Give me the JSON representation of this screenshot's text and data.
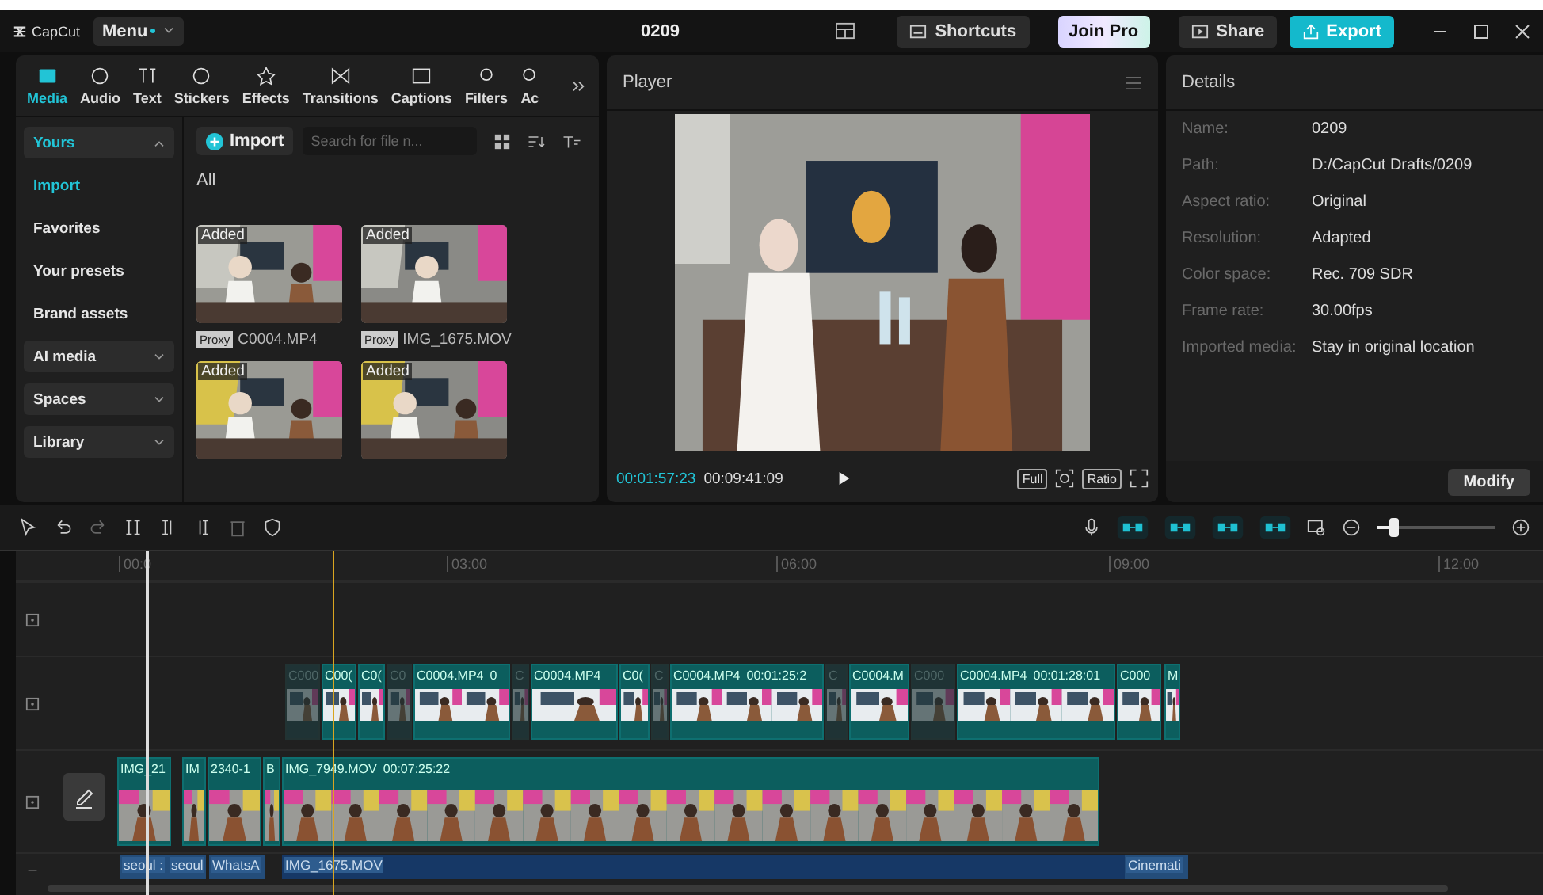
{
  "title_bar": {
    "logo": "CapCut",
    "menu": "Menu",
    "project": "0209",
    "shortcuts": "Shortcuts",
    "join_pro": "Join Pro",
    "share": "Share",
    "export": "Export"
  },
  "tabs": [
    {
      "label": "Media",
      "selected": true
    },
    {
      "label": "Audio",
      "selected": false
    },
    {
      "label": "Text",
      "selected": false
    },
    {
      "label": "Stickers",
      "selected": false
    },
    {
      "label": "Effects",
      "selected": false
    },
    {
      "label": "Transitions",
      "selected": false
    },
    {
      "label": "Captions",
      "selected": false
    },
    {
      "label": "Filters",
      "selected": false
    },
    {
      "label": "Ac",
      "selected": false
    }
  ],
  "sidebar": {
    "items": [
      {
        "label": "Yours",
        "kind": "group",
        "expanded": true,
        "selected": true
      },
      {
        "label": "Import",
        "kind": "item",
        "selected": true
      },
      {
        "label": "Favorites",
        "kind": "item",
        "selected": false
      },
      {
        "label": "Your presets",
        "kind": "item",
        "selected": false
      },
      {
        "label": "Brand assets",
        "kind": "item",
        "selected": false
      },
      {
        "label": "AI media",
        "kind": "group",
        "expanded": false,
        "selected": false
      },
      {
        "label": "Spaces",
        "kind": "group",
        "expanded": false,
        "selected": false
      },
      {
        "label": "Library",
        "kind": "group",
        "expanded": false,
        "selected": false
      }
    ]
  },
  "media": {
    "import": "Import",
    "search": {
      "placeholder": "Search for file n..."
    },
    "filter": "All",
    "files": [
      {
        "badge": "Added",
        "proxy": "Proxy",
        "name": "C0004.MP4"
      },
      {
        "badge": "Added",
        "proxy": "Proxy",
        "name": "IMG_1675.MOV"
      },
      {
        "badge": "Added"
      },
      {
        "badge": "Added"
      }
    ]
  },
  "player": {
    "title": "Player",
    "current_time": "00:01:57:23",
    "duration": "00:09:41:09",
    "full": "Full",
    "ratio": "Ratio"
  },
  "details": {
    "title": "Details",
    "rows": [
      {
        "label": "Name:",
        "value": "0209"
      },
      {
        "label": "Path:",
        "value": "D:/CapCut Drafts/0209"
      },
      {
        "label": "Aspect ratio:",
        "value": "Original"
      },
      {
        "label": "Resolution:",
        "value": "Adapted"
      },
      {
        "label": "Color space:",
        "value": "Rec. 709 SDR"
      },
      {
        "label": "Frame rate:",
        "value": "30.00fps"
      },
      {
        "label": "Imported media:",
        "value": "Stay in original location"
      }
    ],
    "modify": "Modify"
  },
  "timeline": {
    "zoom": {
      "level": 0.15
    },
    "ruler": [
      "00:0",
      "03:00",
      "06:00",
      "09:00",
      "12:00"
    ],
    "overlay_clips": [
      {
        "name": "C000",
        "dim": true
      },
      {
        "name": "C00(",
        "dim": false
      },
      {
        "name": "C0(",
        "dim": false
      },
      {
        "name": "C0",
        "dim": true
      },
      {
        "name": "C0004.MP4",
        "duration": "0",
        "dim": false
      },
      {
        "name": "C",
        "dim": true
      },
      {
        "name": "C0004.MP4",
        "dim": false
      },
      {
        "name": "C0(",
        "dim": false
      },
      {
        "name": "C",
        "dim": true
      },
      {
        "name": "C0004.MP4",
        "duration": "00:01:25:2",
        "dim": false
      },
      {
        "name": "C",
        "dim": true
      },
      {
        "name": "C0004.M",
        "dim": false
      },
      {
        "name": "C000",
        "dim": true
      },
      {
        "name": "C0004.MP4",
        "duration": "00:01:28:01",
        "dim": false
      },
      {
        "name": "C000",
        "dim": false
      },
      {
        "name": "M",
        "dim": false
      }
    ],
    "main_clips": [
      {
        "name": "IMG_21"
      },
      {
        "name": "IM"
      },
      {
        "name": "2340-1"
      },
      {
        "name": "B"
      },
      {
        "name": "IMG_7949.MOV",
        "duration": "00:07:25:22"
      }
    ],
    "text_clips": [
      {
        "name": "seoul :"
      },
      {
        "name": "seoul"
      },
      {
        "name": "WhatsA"
      },
      {
        "name": "IMG_1675.MOV"
      },
      {
        "name": "Cinemati"
      }
    ]
  }
}
